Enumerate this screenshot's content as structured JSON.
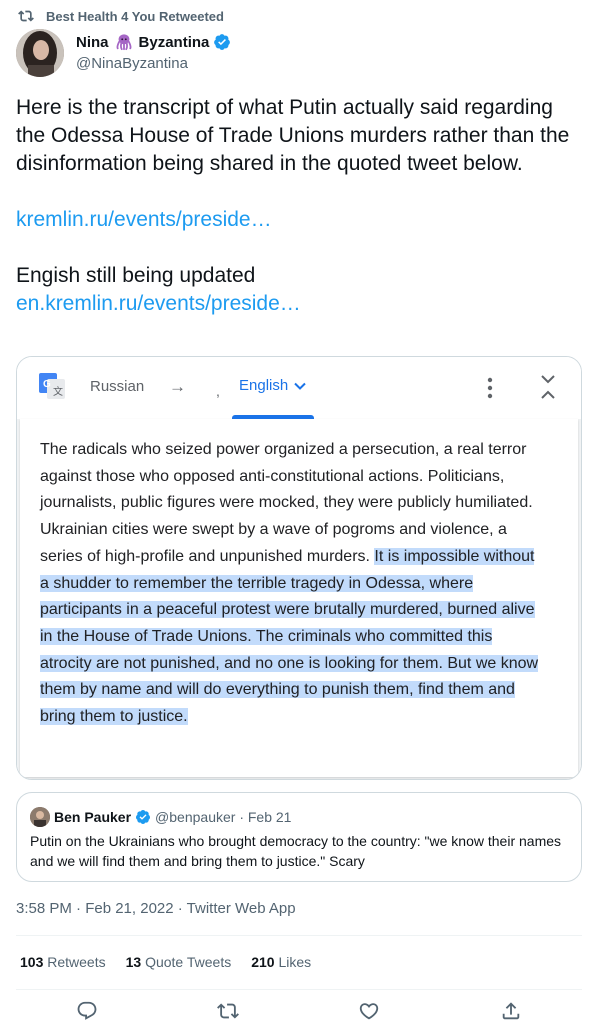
{
  "retweet_context": {
    "text": "Best Health 4 You Retweeted",
    "icon": "retweet-icon"
  },
  "author": {
    "name_first": "Nina",
    "name_emoji": "octopus",
    "name_last": "Byzantina",
    "handle": "@NinaByzantina",
    "verified": true
  },
  "tweet": {
    "paragraph1": "Here is the transcript of what Putin actually said regarding the Odessa House of Trade Unions murders rather than the disinformation being shared in the quoted tweet below.",
    "link1": "kremlin.ru/events/preside…",
    "paragraph2": "Engish still being updated",
    "link2": "en.kremlin.ru/events/preside…"
  },
  "translate": {
    "source_lang": "Russian",
    "arrow": "→",
    "dot": ",",
    "target_lang": "English",
    "text_plain": "The radicals who seized power organized a persecution, a real terror against those who opposed anti-constitutional actions. Politicians, journalists, public figures were mocked, they were publicly humiliated. Ukrainian cities were swept by a wave of pogroms and violence, a series of high-profile and unpunished murders. ",
    "text_highlighted": "It is impossible without a shudder to remember the terrible tragedy in Odessa, where participants in a peaceful protest were brutally murdered, burned alive in the House of Trade Unions. The criminals who committed this atrocity are not punished, and no one is looking for them. But we know them by name and will do everything to punish them, find them and bring them to justice."
  },
  "quote_tweet": {
    "name": "Ben Pauker",
    "verified": true,
    "meta": "@benpauker · Feb 21",
    "text": "Putin on the Ukrainians who brought democracy to the country: \"we know their names and we will find them and bring them to justice.\" Scary"
  },
  "timestamp": "3:58 PM · Feb 21, 2022 · Twitter Web App",
  "stats": {
    "retweets_count": "103",
    "retweets_label": "Retweets",
    "quotes_count": "13",
    "quotes_label": "Quote Tweets",
    "likes_count": "210",
    "likes_label": "Likes"
  },
  "colors": {
    "accent": "#1d9bf0",
    "highlight": "#c2dbfb",
    "google_blue": "#1a73e8"
  }
}
